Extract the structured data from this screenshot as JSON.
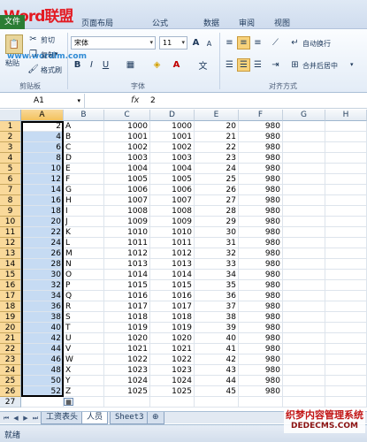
{
  "app": {
    "logo_text": "Word联盟",
    "watermark": "www.wordlm.com",
    "file_tab": "文件",
    "menu_tabs": [
      "页面布局",
      "公式",
      "数据",
      "审阅",
      "视图"
    ]
  },
  "ribbon": {
    "clipboard": {
      "paste": "粘贴",
      "cut": "剪切",
      "copy": "复制",
      "format_painter": "格式刷",
      "label": "剪贴板"
    },
    "font": {
      "name": "宋体",
      "size": "11",
      "bold": "B",
      "italic": "I",
      "underline": "U",
      "label": "字体",
      "inc_size": "A",
      "dec_size": "A",
      "wen": "文"
    },
    "alignment": {
      "wrap_text": "自动换行",
      "merge_center": "合并后居中",
      "label": "对齐方式"
    }
  },
  "formula_bar": {
    "cell_ref": "A1",
    "fx": "fx",
    "value": "2"
  },
  "columns": [
    "A",
    "B",
    "C",
    "D",
    "E",
    "F",
    "G",
    "H"
  ],
  "rows": [
    {
      "n": "1",
      "a": "2",
      "b": "A",
      "c": "1000",
      "d": "1000",
      "e": "20",
      "f": "980"
    },
    {
      "n": "2",
      "a": "4",
      "b": "B",
      "c": "1001",
      "d": "1001",
      "e": "21",
      "f": "980"
    },
    {
      "n": "3",
      "a": "6",
      "b": "C",
      "c": "1002",
      "d": "1002",
      "e": "22",
      "f": "980"
    },
    {
      "n": "4",
      "a": "8",
      "b": "D",
      "c": "1003",
      "d": "1003",
      "e": "23",
      "f": "980"
    },
    {
      "n": "5",
      "a": "10",
      "b": "E",
      "c": "1004",
      "d": "1004",
      "e": "24",
      "f": "980"
    },
    {
      "n": "6",
      "a": "12",
      "b": "F",
      "c": "1005",
      "d": "1005",
      "e": "25",
      "f": "980"
    },
    {
      "n": "7",
      "a": "14",
      "b": "G",
      "c": "1006",
      "d": "1006",
      "e": "26",
      "f": "980"
    },
    {
      "n": "8",
      "a": "16",
      "b": "H",
      "c": "1007",
      "d": "1007",
      "e": "27",
      "f": "980"
    },
    {
      "n": "9",
      "a": "18",
      "b": "I",
      "c": "1008",
      "d": "1008",
      "e": "28",
      "f": "980"
    },
    {
      "n": "10",
      "a": "20",
      "b": "J",
      "c": "1009",
      "d": "1009",
      "e": "29",
      "f": "980"
    },
    {
      "n": "11",
      "a": "22",
      "b": "K",
      "c": "1010",
      "d": "1010",
      "e": "30",
      "f": "980"
    },
    {
      "n": "12",
      "a": "24",
      "b": "L",
      "c": "1011",
      "d": "1011",
      "e": "31",
      "f": "980"
    },
    {
      "n": "13",
      "a": "26",
      "b": "M",
      "c": "1012",
      "d": "1012",
      "e": "32",
      "f": "980"
    },
    {
      "n": "14",
      "a": "28",
      "b": "N",
      "c": "1013",
      "d": "1013",
      "e": "33",
      "f": "980"
    },
    {
      "n": "15",
      "a": "30",
      "b": "O",
      "c": "1014",
      "d": "1014",
      "e": "34",
      "f": "980"
    },
    {
      "n": "16",
      "a": "32",
      "b": "P",
      "c": "1015",
      "d": "1015",
      "e": "35",
      "f": "980"
    },
    {
      "n": "17",
      "a": "34",
      "b": "Q",
      "c": "1016",
      "d": "1016",
      "e": "36",
      "f": "980"
    },
    {
      "n": "18",
      "a": "36",
      "b": "R",
      "c": "1017",
      "d": "1017",
      "e": "37",
      "f": "980"
    },
    {
      "n": "19",
      "a": "38",
      "b": "S",
      "c": "1018",
      "d": "1018",
      "e": "38",
      "f": "980"
    },
    {
      "n": "20",
      "a": "40",
      "b": "T",
      "c": "1019",
      "d": "1019",
      "e": "39",
      "f": "980"
    },
    {
      "n": "21",
      "a": "42",
      "b": "U",
      "c": "1020",
      "d": "1020",
      "e": "40",
      "f": "980"
    },
    {
      "n": "22",
      "a": "44",
      "b": "V",
      "c": "1021",
      "d": "1021",
      "e": "41",
      "f": "980"
    },
    {
      "n": "23",
      "a": "46",
      "b": "W",
      "c": "1022",
      "d": "1022",
      "e": "42",
      "f": "980"
    },
    {
      "n": "24",
      "a": "48",
      "b": "X",
      "c": "1023",
      "d": "1023",
      "e": "43",
      "f": "980"
    },
    {
      "n": "25",
      "a": "50",
      "b": "Y",
      "c": "1024",
      "d": "1024",
      "e": "44",
      "f": "980"
    },
    {
      "n": "26",
      "a": "52",
      "b": "Z",
      "c": "1025",
      "d": "1025",
      "e": "45",
      "f": "980"
    },
    {
      "n": "27",
      "a": "",
      "b": "",
      "c": "",
      "d": "",
      "e": "",
      "f": ""
    }
  ],
  "sheets": [
    "工资表头",
    "人员",
    "Sheet3"
  ],
  "active_sheet": "人员",
  "status": "就绪",
  "site_tag": {
    "line1": "织梦内容管理系统",
    "line2": "DEDECMS.COM"
  },
  "colors": {
    "accent": "#f9d99a",
    "selection": "#c6dbf3",
    "file_tab": "#2a7d34",
    "logo": "#e31b23"
  },
  "icons": [
    "paste-icon",
    "cut-icon",
    "copy-icon",
    "format-painter-icon",
    "bold-icon",
    "italic-icon",
    "underline-icon",
    "align-icon",
    "wrap-text-icon",
    "merge-center-icon",
    "fx-icon",
    "sheet-nav-icon",
    "autofill-options-icon"
  ]
}
